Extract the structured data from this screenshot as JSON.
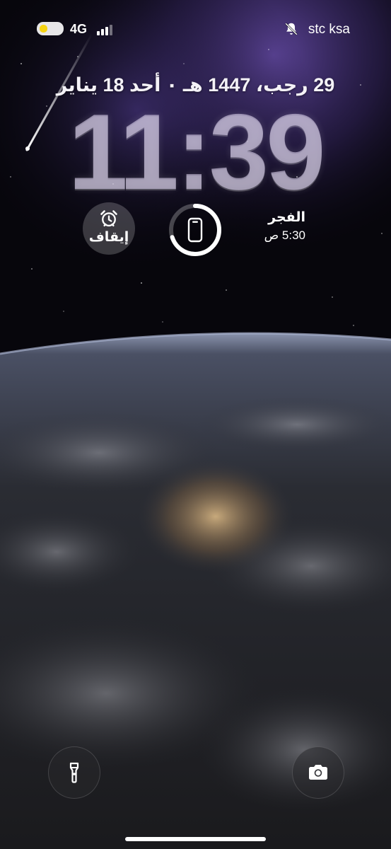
{
  "status_bar": {
    "network_type": "4G",
    "carrier": "stc ksa",
    "battery_level": 0.35,
    "signal_bars_active": 3,
    "signal_bars_total": 4,
    "battery_color": "#f5d312"
  },
  "lock_screen": {
    "date": "29 رجب، 1447 هـ ٠ أحد 18 يناير",
    "time": "11:39"
  },
  "widgets": {
    "alarm": {
      "icon": "alarm-clock-icon",
      "label": "إيقاف"
    },
    "battery": {
      "icon": "iphone-icon",
      "charge_fraction": 0.7
    },
    "prayer": {
      "name": "الفجر",
      "time": "5:30 ص"
    }
  },
  "quick_actions": {
    "camera": {
      "icon": "camera-icon"
    },
    "flashlight": {
      "icon": "flashlight-icon"
    }
  },
  "colors": {
    "accent_purple": "#7a5ec8",
    "background": "#07060c"
  }
}
